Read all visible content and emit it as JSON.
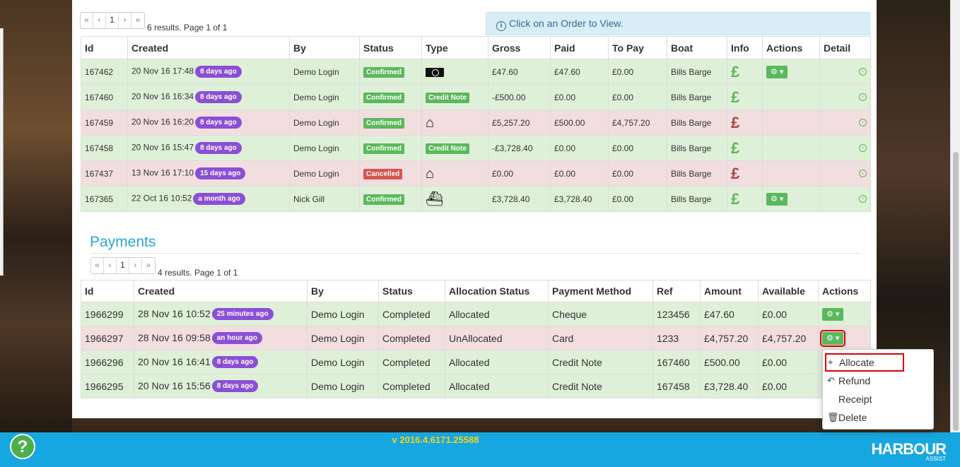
{
  "orders": {
    "pager": [
      "«",
      "‹",
      "1",
      "›",
      "»"
    ],
    "results_text": "6 results. Page 1 of 1",
    "info_text": "Click on an Order to View.",
    "headers": [
      "Id",
      "Created",
      "By",
      "Status",
      "Type",
      "Gross",
      "Paid",
      "To Pay",
      "Boat",
      "Info",
      "Actions",
      "Detail"
    ],
    "rows": [
      {
        "id": "167462",
        "created": "20 Nov 16 17:48",
        "ago": "8 days ago",
        "by": "Demo Login",
        "status": "Confirmed",
        "status_color": "green",
        "type": "cash-icon",
        "type_label": "",
        "gross": "£47.60",
        "paid": "£47.60",
        "topay": "£0.00",
        "boat": "Bills Barge",
        "info": "£",
        "info_color": "green",
        "actions": true,
        "row": "ok"
      },
      {
        "id": "167460",
        "created": "20 Nov 16 16:34",
        "ago": "8 days ago",
        "by": "Demo Login",
        "status": "Confirmed",
        "status_color": "green",
        "type": "credit-note",
        "type_label": "Credit Note",
        "gross": "-£500.00",
        "paid": "£0.00",
        "topay": "£0.00",
        "boat": "Bills Barge",
        "info": "£",
        "info_color": "green",
        "actions": false,
        "row": "ok"
      },
      {
        "id": "167459",
        "created": "20 Nov 16 16:20",
        "ago": "8 days ago",
        "by": "Demo Login",
        "status": "Confirmed",
        "status_color": "green",
        "type": "house-icon",
        "type_label": "",
        "gross": "£5,257.20",
        "paid": "£500.00",
        "topay": "£4,757.20",
        "boat": "Bills Barge",
        "info": "£",
        "info_color": "red",
        "actions": false,
        "row": "bad"
      },
      {
        "id": "167458",
        "created": "20 Nov 16 15:47",
        "ago": "8 days ago",
        "by": "Demo Login",
        "status": "Confirmed",
        "status_color": "green",
        "type": "credit-note",
        "type_label": "Credit Note",
        "gross": "-£3,728.40",
        "paid": "£0.00",
        "topay": "£0.00",
        "boat": "Bills Barge",
        "info": "£",
        "info_color": "green",
        "actions": false,
        "row": "ok"
      },
      {
        "id": "167437",
        "created": "13 Nov 16 17:10",
        "ago": "15 days ago",
        "by": "Demo Login",
        "status": "Cancelled",
        "status_color": "red",
        "type": "house-icon",
        "type_label": "",
        "gross": "£0.00",
        "paid": "£0.00",
        "topay": "£0.00",
        "boat": "Bills Barge",
        "info": "£",
        "info_color": "red",
        "actions": false,
        "row": "bad"
      },
      {
        "id": "167365",
        "created": "22 Oct 16 10:52",
        "ago": "a month ago",
        "by": "Nick Gill",
        "status": "Confirmed",
        "status_color": "green",
        "type": "boat-icon",
        "type_label": "",
        "gross": "£3,728.40",
        "paid": "£3,728.40",
        "topay": "£0.00",
        "boat": "Bills Barge",
        "info": "£",
        "info_color": "green",
        "actions": true,
        "row": "ok"
      }
    ]
  },
  "payments": {
    "title": "Payments",
    "pager": [
      "«",
      "‹",
      "1",
      "›",
      "»"
    ],
    "results_text": "4 results. Page 1 of 1",
    "headers": [
      "Id",
      "Created",
      "By",
      "Status",
      "Allocation Status",
      "Payment Method",
      "Ref",
      "Amount",
      "Available",
      "Actions"
    ],
    "rows": [
      {
        "id": "1966299",
        "created": "28 Nov 16 10:52",
        "ago": "25 minutes ago",
        "by": "Demo Login",
        "status": "Completed",
        "alloc": "Allocated",
        "method": "Cheque",
        "ref": "123456",
        "amount": "£47.60",
        "available": "£0.00",
        "row": "ok"
      },
      {
        "id": "1966297",
        "created": "28 Nov 16 09:58",
        "ago": "an hour ago",
        "by": "Demo Login",
        "status": "Completed",
        "alloc": "UnAllocated",
        "method": "Card",
        "ref": "1233",
        "amount": "£4,757.20",
        "available": "£4,757.20",
        "row": "bad"
      },
      {
        "id": "1966296",
        "created": "20 Nov 16 16:41",
        "ago": "8 days ago",
        "by": "Demo Login",
        "status": "Completed",
        "alloc": "Allocated",
        "method": "Credit Note",
        "ref": "167460",
        "amount": "£500.00",
        "available": "£0.00",
        "row": "ok"
      },
      {
        "id": "1966295",
        "created": "20 Nov 16 15:56",
        "ago": "8 days ago",
        "by": "Demo Login",
        "status": "Completed",
        "alloc": "Allocated",
        "method": "Credit Note",
        "ref": "167458",
        "amount": "£3,728.40",
        "available": "£0.00",
        "row": "ok"
      }
    ]
  },
  "dropdown": {
    "items": [
      {
        "label": "Allocate",
        "icon": "crosshair-icon",
        "glyph": "⌖"
      },
      {
        "label": "Refund",
        "icon": "undo-icon",
        "glyph": "↶"
      },
      {
        "label": "Receipt",
        "icon": "",
        "glyph": ""
      },
      {
        "label": "Delete",
        "icon": "trash-icon",
        "glyph": "🗑"
      }
    ]
  },
  "footer": {
    "version": "v 2016.4.6171.25588",
    "help": "?",
    "brand": "HARBOUR",
    "brand_sub": "ASSIST"
  },
  "colors": {
    "footer": "#17a7e0",
    "row_ok": "#dff0d8",
    "row_bad": "#f2dede",
    "badge": "#8b4fd6",
    "payments_title": "#2aa6d9",
    "version": "#f5d020"
  }
}
